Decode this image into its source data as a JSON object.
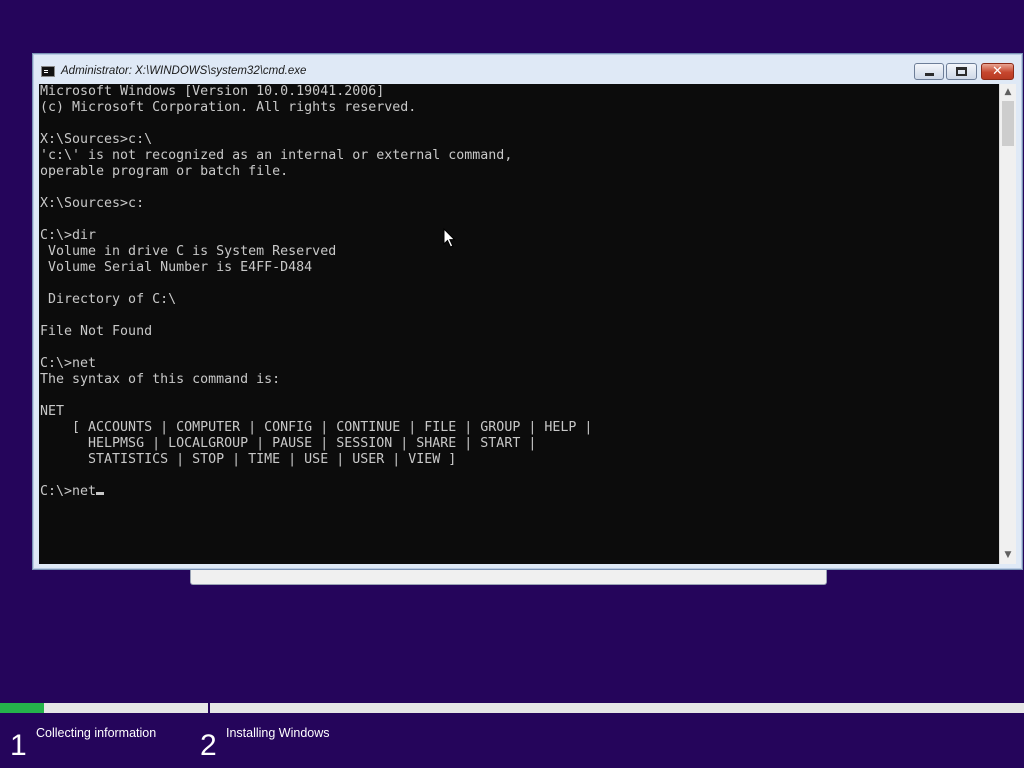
{
  "window": {
    "title": "Administrator: X:\\WINDOWS\\system32\\cmd.exe",
    "icon": "cmd-icon",
    "buttons": {
      "minimize": "minimize-icon",
      "maximize": "maximize-icon",
      "close_label": "✕"
    }
  },
  "console": {
    "lines": [
      "Microsoft Windows [Version 10.0.19041.2006]",
      "(c) Microsoft Corporation. All rights reserved.",
      "",
      "X:\\Sources>c:\\",
      "'c:\\' is not recognized as an internal or external command,",
      "operable program or batch file.",
      "",
      "X:\\Sources>c:",
      "",
      "C:\\>dir",
      " Volume in drive C is System Reserved",
      " Volume Serial Number is E4FF-D484",
      "",
      " Directory of C:\\",
      "",
      "File Not Found",
      "",
      "C:\\>net",
      "The syntax of this command is:",
      "",
      "NET",
      "    [ ACCOUNTS | COMPUTER | CONFIG | CONTINUE | FILE | GROUP | HELP |",
      "      HELPMSG | LOCALGROUP | PAUSE | SESSION | SHARE | START |",
      "      STATISTICS | STOP | TIME | USE | USER | VIEW ]",
      ""
    ],
    "prompt_line": "C:\\>net",
    "scroll_up_glyph": "▲",
    "scroll_down_glyph": "▼"
  },
  "setup": {
    "progress_fraction": 0.043,
    "steps": [
      {
        "number": "1",
        "label": "Collecting information"
      },
      {
        "number": "2",
        "label": "Installing Windows"
      }
    ]
  },
  "colors": {
    "background": "#25055b",
    "progress": "#25b34b",
    "console_bg": "#0c0c0c",
    "console_fg": "#c8c8c8"
  }
}
